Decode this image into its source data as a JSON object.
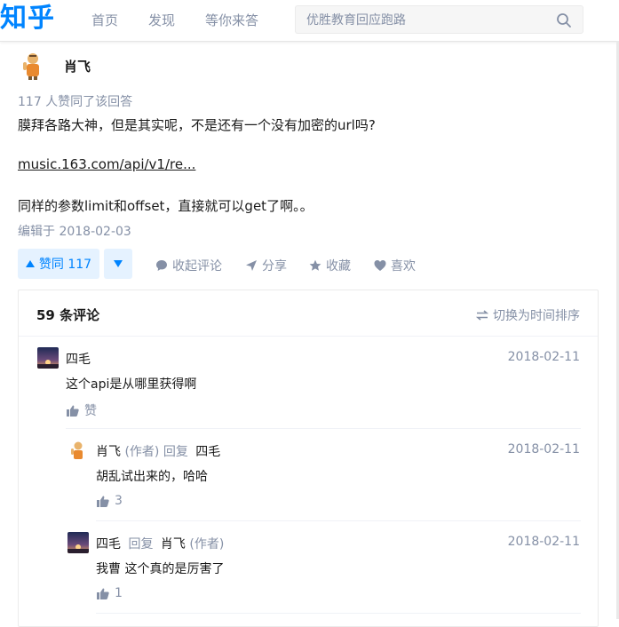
{
  "header": {
    "logo": "知乎",
    "nav": [
      "首页",
      "发现",
      "等你来答"
    ],
    "search_placeholder": "优胜教育回应跑路"
  },
  "answer": {
    "author": "肖飞",
    "votes_line": "117 人赞同了该回答",
    "paragraph1": "膜拜各路大神，但是其实呢，不是还有一个没有加密的url吗?",
    "link": "music.163.com/api/v1/re...",
    "paragraph2": "同样的参数limit和offset，直接就可以get了啊。。",
    "edited": "编辑于 2018-02-03"
  },
  "actions": {
    "vote": "赞同 117",
    "collapse_comments": "收起评论",
    "share": "分享",
    "favorite": "收藏",
    "like": "喜欢"
  },
  "comments": {
    "count": "59 条评论",
    "sort": "切换为时间排序",
    "items": [
      {
        "name": "四毛",
        "date": "2018-02-11",
        "text": "这个api是从哪里获得啊",
        "likes": "赞"
      },
      {
        "name": "肖飞",
        "author_tag": "(作者)",
        "reply": "回复",
        "target": "四毛",
        "date": "2018-02-11",
        "text": "胡乱试出来的，哈哈",
        "likes": "3"
      },
      {
        "name": "四毛",
        "reply": "回复",
        "target": "肖飞",
        "target_tag": "(作者)",
        "date": "2018-02-11",
        "text": "我曹 这个真的是厉害了",
        "likes": "1"
      }
    ]
  },
  "colors": {
    "brand": "#0084ff",
    "muted": "#8590a6",
    "vote_bg": "#e5f2ff"
  }
}
